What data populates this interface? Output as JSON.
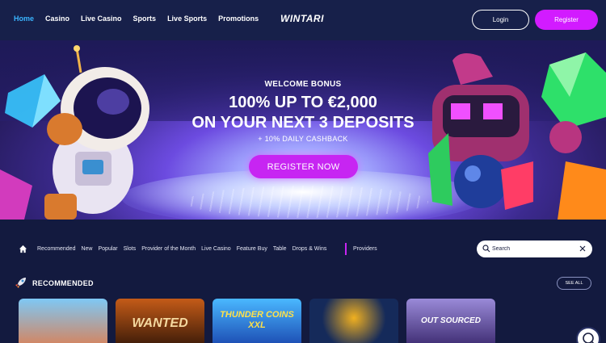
{
  "header": {
    "nav": [
      "Home",
      "Casino",
      "Live Casino",
      "Sports",
      "Live Sports",
      "Promotions"
    ],
    "active_nav": "Home",
    "logo": "WINTARI",
    "login_label": "Login",
    "register_label": "Register"
  },
  "banner": {
    "welcome": "WELCOME BONUS",
    "line1": "100% UP TO €2,000",
    "line2": "ON YOUR NEXT 3 DEPOSITS",
    "cashback": "+ 10% DAILY CASHBACK",
    "cta": "REGISTER NOW"
  },
  "categories": {
    "items": [
      "Recommended",
      "New",
      "Popular",
      "Slots",
      "Provider of the Month",
      "Live Casino",
      "Feature Buy",
      "Table",
      "Drops & Wins"
    ],
    "providers": "Providers"
  },
  "search": {
    "placeholder": "Search"
  },
  "recommended": {
    "title": "RECOMMENDED",
    "see_all": "SEE ALL",
    "games": [
      {
        "label": "",
        "bg": "#4aa0e0"
      },
      {
        "label": "WANTED",
        "bg": "#7a3a12"
      },
      {
        "label": "THUNDER COINS XXL",
        "bg": "#2a7fe0"
      },
      {
        "label": "",
        "bg": "#152a5a"
      },
      {
        "label": "OUT SOURCED",
        "bg": "#5a4aa0"
      }
    ]
  },
  "colors": {
    "accent": "#d21bff",
    "active_nav": "#3ab4ff",
    "background": "#131a3f"
  }
}
